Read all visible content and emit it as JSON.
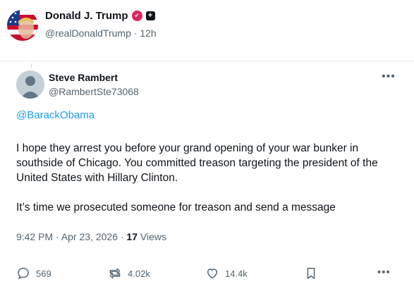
{
  "author": {
    "name": "Donald J. Trump",
    "handle": "@realDonaldTrump",
    "separator": "·",
    "time": "12h"
  },
  "quoted": {
    "name": "Steve Rambert",
    "handle": "@RambertSte73068",
    "mention": "@BarackObama",
    "paragraphs": [
      "I hope they arrest you before your grand opening of your war bunker in southside of Chicago. You committed treason targeting the president of the United States with Hillary Clinton.",
      "It’s time we prosecuted someone for treason and send a message"
    ],
    "timestamp": "9:42 PM · Apr 23, 2026 · ",
    "views_count": "17",
    "views_label": "Views"
  },
  "actions": {
    "replies": "569",
    "reposts": "4.02k",
    "likes": "14.4k"
  },
  "colors": {
    "accent": "#1d9bf0",
    "secondary_text": "#536471",
    "verified_badge": "#e0245e"
  },
  "icons": [
    "reply-icon",
    "repost-icon",
    "like-icon",
    "bookmark-icon",
    "more-icon",
    "verified-badge-icon",
    "plus-badge-icon"
  ]
}
